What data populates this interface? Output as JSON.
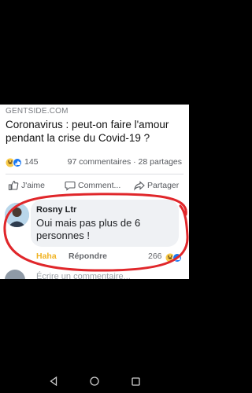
{
  "post": {
    "source": "GENTSIDE.COM",
    "title": "Coronavirus : peut-on faire l'amour pendant la crise du Covid-19 ?",
    "reaction_count": "145",
    "stats_right": "97 commentaires · 28 partages",
    "actions": {
      "like": "J'aime",
      "comment": "Comment...",
      "share": "Partager"
    }
  },
  "comment": {
    "author": "Rosny Ltr",
    "text": "Oui mais pas plus de 6 personnes !",
    "haha_label": "Haha",
    "reply_label": "Répondre",
    "reaction_count": "266"
  },
  "next_comment": {
    "text": "Écrire un commentaire..."
  },
  "colors": {
    "annotation_circle": "#e0262a",
    "haha": "#f0b323",
    "like_blue": "#1877f2"
  }
}
